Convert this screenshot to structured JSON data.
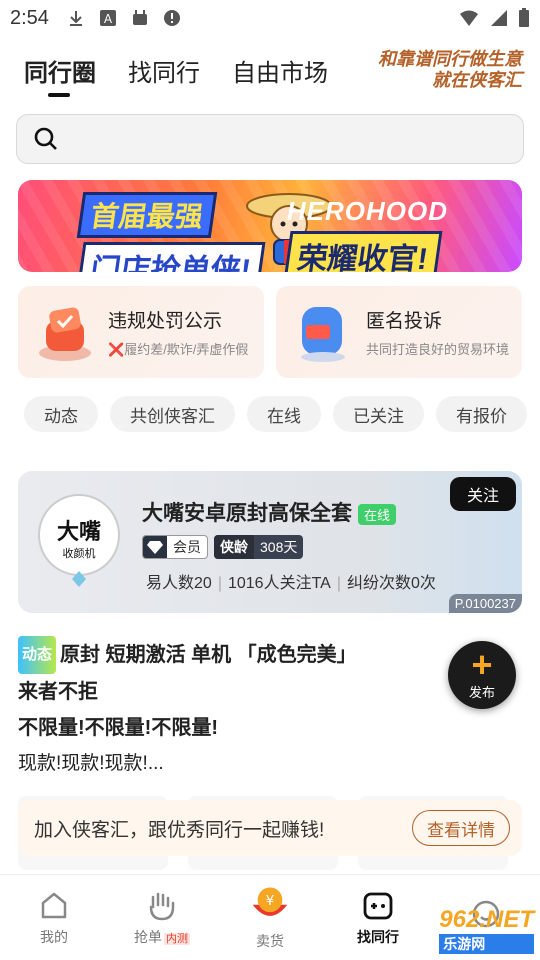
{
  "status_bar": {
    "time": "2:54"
  },
  "header": {
    "tabs": [
      {
        "label": "同行圈",
        "active": true
      },
      {
        "label": "找同行",
        "active": false
      },
      {
        "label": "自由市场",
        "active": false
      }
    ],
    "slogan_line1": "和靠谱同行做生意",
    "slogan_line2": "就在侠客汇"
  },
  "search": {
    "placeholder": ""
  },
  "banner": {
    "line1": "首届最强",
    "line2": "门店抢单侠!",
    "right_title": "HEROHOOD",
    "right_sub": "荣耀收官!"
  },
  "features": [
    {
      "title": "违规处罚公示",
      "subtitle_mark": "❌",
      "subtitle": "履约差/欺诈/弄虚作假"
    },
    {
      "title": "匿名投诉",
      "subtitle": "共同打造良好的贸易环境",
      "icon_label": "投诉"
    }
  ],
  "chips": [
    "动态",
    "共创侠客汇",
    "在线",
    "已关注",
    "有报价"
  ],
  "shop": {
    "name": "大嘴安卓原封高保全套",
    "online": "在线",
    "member_label": "会员",
    "years_label": "侠龄",
    "years_value": "308天",
    "stat_deals": "易人数20",
    "stat_followers": "1016人关注TA",
    "stat_disputes": "纠纷次数0次",
    "follow_label": "关注",
    "id": "P.0100237",
    "avatar_text1": "大嘴",
    "avatar_text2": "收颜机"
  },
  "post": {
    "tag": "动态",
    "line1": "原封 短期激活 单机 「成色完美」",
    "line2": "来者不拒",
    "line3": "不限量!不限量!不限量!",
    "line4": "现款!现款!现款!..."
  },
  "fab": {
    "label": "发布"
  },
  "join": {
    "text": "加入侠客汇，跟优秀同行一起赚钱!",
    "button": "查看详情"
  },
  "nav": {
    "items": [
      {
        "label": "我的"
      },
      {
        "label": "抢单",
        "badge": "内测"
      },
      {
        "label": "卖货"
      },
      {
        "label": "找同行",
        "active": true
      },
      {
        "label": ""
      }
    ]
  },
  "watermark": {
    "brand": "962.NET",
    "sub": "乐游网"
  },
  "colors": {
    "accent": "#b5622a",
    "online": "#3ecf6b",
    "fab_plus": "#f5a623"
  }
}
